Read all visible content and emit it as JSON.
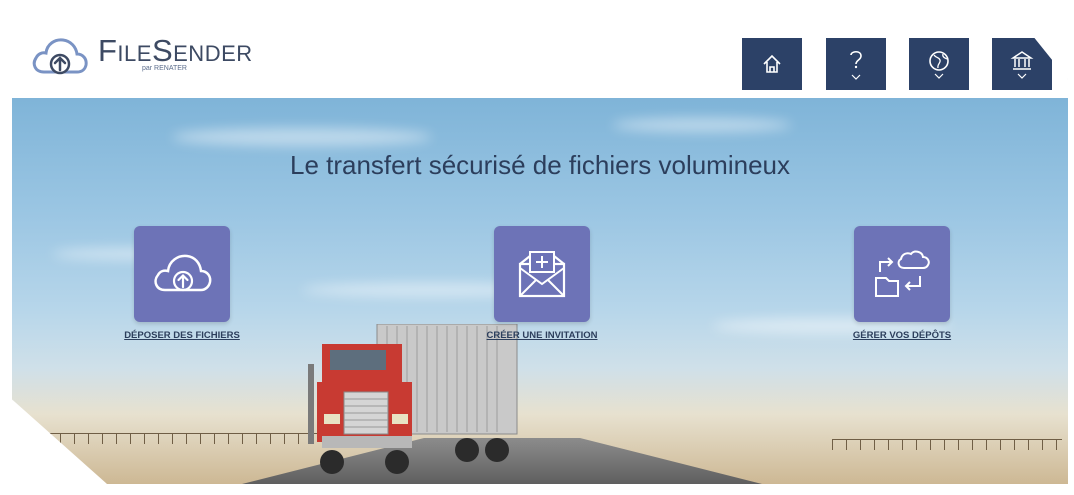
{
  "brand": {
    "name": "FileSender",
    "subtitle": "par RENATER"
  },
  "nav": [
    {
      "id": "home",
      "icon": "home-icon"
    },
    {
      "id": "help",
      "icon": "help-icon"
    },
    {
      "id": "language",
      "icon": "globe-icon"
    },
    {
      "id": "institution",
      "icon": "institution-icon"
    }
  ],
  "hero": {
    "title": "Le transfert sécurisé de fichiers volumineux",
    "actions": [
      {
        "label": "DÉPOSER DES FICHIERS",
        "icon": "cloud-upload-icon"
      },
      {
        "label": "CRÉER UNE INVITATION",
        "icon": "envelope-plus-icon"
      },
      {
        "label": "GÉRER VOS DÉPÔTS",
        "icon": "manage-transfers-icon"
      }
    ]
  },
  "colors": {
    "nav": "#2c4167",
    "tile": "#6d73b7",
    "text": "#2c3e5c"
  }
}
